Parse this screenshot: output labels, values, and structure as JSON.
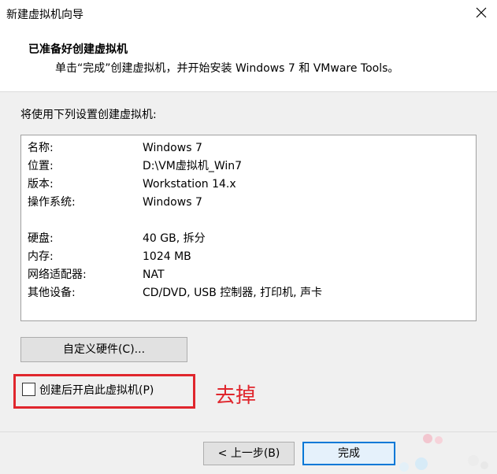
{
  "window": {
    "title": "新建虚拟机向导"
  },
  "header": {
    "title": "已准备好创建虚拟机",
    "subtitle": "单击“完成”创建虚拟机，并开始安装 Windows 7 和 VMware Tools。"
  },
  "intro": "将使用下列设置创建虚拟机:",
  "summary": [
    {
      "key": "名称:",
      "value": "Windows 7"
    },
    {
      "key": "位置:",
      "value": "D:\\VM虚拟机_Win7"
    },
    {
      "key": "版本:",
      "value": "Workstation 14.x"
    },
    {
      "key": "操作系统:",
      "value": "Windows 7"
    },
    {
      "key": "硬盘:",
      "value": "40 GB, 拆分"
    },
    {
      "key": "内存:",
      "value": "1024 MB"
    },
    {
      "key": "网络适配器:",
      "value": "NAT"
    },
    {
      "key": "其他设备:",
      "value": "CD/DVD, USB 控制器, 打印机, 声卡"
    }
  ],
  "customize_button": "自定义硬件(C)...",
  "power_on_checkbox": {
    "label": "创建后开启此虚拟机(P)",
    "checked": false
  },
  "annotation": {
    "text": "去掉",
    "color": "#e0262d"
  },
  "footer": {
    "back_label": "< 上一步(B)",
    "finish_label": "完成"
  },
  "colors": {
    "accent": "#0078d7",
    "panel": "#f0f0f0"
  }
}
